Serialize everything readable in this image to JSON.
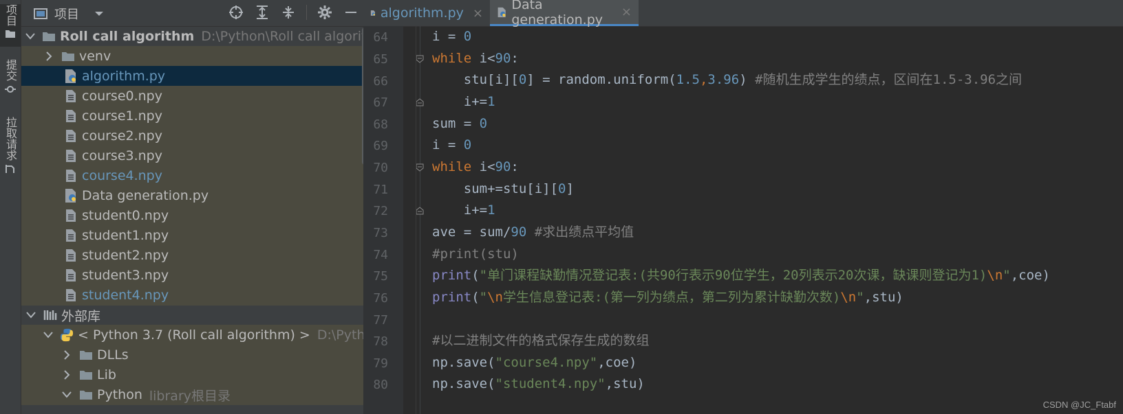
{
  "left_strip": {
    "tab1": "项目",
    "tab2": "提交",
    "tab3": "拉取请求"
  },
  "project_panel": {
    "title": "项目",
    "tree": [
      {
        "label": "Roll call algorithm",
        "path": "D:\\Python\\Roll call algorithm",
        "type": "folder",
        "level": 0
      },
      {
        "label": "venv",
        "type": "folder",
        "level": 1
      },
      {
        "label": "algorithm.py",
        "type": "py",
        "level": 1
      },
      {
        "label": "course0.npy",
        "type": "file",
        "level": 1
      },
      {
        "label": "course1.npy",
        "type": "file",
        "level": 1
      },
      {
        "label": "course2.npy",
        "type": "file",
        "level": 1
      },
      {
        "label": "course3.npy",
        "type": "file",
        "level": 1
      },
      {
        "label": "course4.npy",
        "type": "file",
        "level": 1
      },
      {
        "label": "Data generation.py",
        "type": "py",
        "level": 1
      },
      {
        "label": "student0.npy",
        "type": "file",
        "level": 1
      },
      {
        "label": "student1.npy",
        "type": "file",
        "level": 1
      },
      {
        "label": "student2.npy",
        "type": "file",
        "level": 1
      },
      {
        "label": "student3.npy",
        "type": "file",
        "level": 1
      },
      {
        "label": "student4.npy",
        "type": "file",
        "level": 1
      },
      {
        "label": "外部库",
        "type": "lib",
        "level": 0
      },
      {
        "label": "< Python 3.7 (Roll call algorithm) >",
        "path": "D:\\Python\\",
        "type": "python",
        "level": 1
      },
      {
        "label": "DLLs",
        "type": "folder",
        "level": 2
      },
      {
        "label": "Lib",
        "type": "folder",
        "level": 2
      },
      {
        "label": "Python",
        "path": "library根目录",
        "type": "folder",
        "level": 2
      }
    ]
  },
  "editor": {
    "tabs": [
      {
        "label": "algorithm.py",
        "close": "×"
      },
      {
        "label": "Data generation.py",
        "close": "×"
      }
    ],
    "line_numbers": [
      "64",
      "65",
      "66",
      "67",
      "68",
      "69",
      "70",
      "71",
      "72",
      "73",
      "74",
      "75",
      "76",
      "77",
      "78",
      "79",
      "80"
    ],
    "code": {
      "l64": [
        "i = ",
        "0"
      ],
      "l65": [
        "while",
        " i<",
        "90",
        ":"
      ],
      "l66": [
        "    stu[i][",
        "0",
        "] = random.uniform(",
        "1.5",
        ",",
        "3.96",
        ") ",
        "#随机生成学生的绩点，区间在1.5-3.96之间"
      ],
      "l67": [
        "    i+=",
        "1"
      ],
      "l68": [
        "sum = ",
        "0"
      ],
      "l69": [
        "i = ",
        "0"
      ],
      "l70": [
        "while",
        " i<",
        "90",
        ":"
      ],
      "l71": [
        "    sum+=stu[i][",
        "0",
        "]"
      ],
      "l72": [
        "    i+=",
        "1"
      ],
      "l73": [
        "ave = sum/",
        "90",
        " ",
        "#求出绩点平均值"
      ],
      "l74": [
        "#print(stu)"
      ],
      "l75": [
        "print",
        "(",
        "\"单门课程缺勤情况登记表:(共90行表示90位学生，20列表示20次课，缺课则登记为1)",
        "\\n",
        "\"",
        ",coe)"
      ],
      "l76": [
        "print",
        "(",
        "\"",
        "\\n",
        "学生信息登记表:(第一列为绩点，第二列为累计缺勤次数)",
        "\\n",
        "\"",
        ",stu)"
      ],
      "l77": [
        ""
      ],
      "l78": [
        "#以二进制文件的格式保存生成的数组"
      ],
      "l79": [
        "np.save(",
        "\"course4.npy\"",
        ",coe)"
      ],
      "l80": [
        "np.save(",
        "\"student4.npy\"",
        ",stu)"
      ]
    }
  },
  "watermark": "CSDN @JC_Ftabf",
  "colors": {
    "keyword": "#cc7832",
    "number": "#6897bb",
    "string": "#6a8759",
    "comment": "#808080",
    "builtin": "#8888c6",
    "selection": "#0d293e"
  }
}
